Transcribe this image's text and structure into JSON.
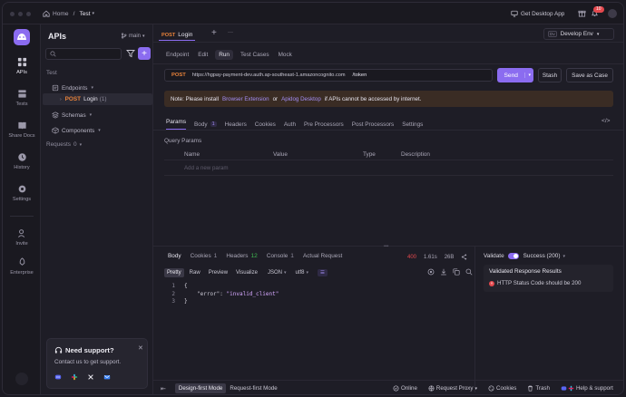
{
  "topbar": {
    "home": "Home",
    "sep": "/",
    "project": "Test",
    "get_desktop": "Get Desktop App",
    "notif_count": "10"
  },
  "rail": {
    "items": [
      {
        "label": "APIs"
      },
      {
        "label": "Tests"
      },
      {
        "label": "Share Docs"
      },
      {
        "label": "History"
      },
      {
        "label": "Settings"
      },
      {
        "label": "Invite"
      },
      {
        "label": "Enterprise"
      }
    ]
  },
  "sidebar": {
    "title": "APIs",
    "branch": "main",
    "tree": {
      "root": "Test",
      "endpoints": "Endpoints",
      "method": "POST",
      "endpoint_name": "Login",
      "endpoint_count": "(1)",
      "schemas": "Schemas",
      "components": "Components",
      "requests": "Requests",
      "requests_count": "0"
    },
    "support": {
      "title": "Need support?",
      "subtitle": "Contact us to get support."
    }
  },
  "main": {
    "tab": {
      "method": "POST",
      "name": "Login"
    },
    "env": "Develop Env",
    "subtabs": [
      "Endpoint",
      "Edit",
      "Run",
      "Test Cases",
      "Mock"
    ],
    "request": {
      "method": "POST",
      "base_url": "https://hgpay-payment-dev.auth.ap-southeast-1.amazoncognito.com",
      "path": "/token",
      "send": "Send",
      "stash": "Stash",
      "save": "Save as Case"
    },
    "note": {
      "prefix": "Note: Please install",
      "link1": "Browser Extension",
      "or": "or",
      "link2": "Apidog Desktop",
      "suffix": "if APIs cannot be accessed by internet."
    },
    "param_tabs": [
      "Params",
      "Body",
      "Headers",
      "Cookies",
      "Auth",
      "Pre Processors",
      "Post Processors",
      "Settings"
    ],
    "body_count": "1",
    "query_params": {
      "label": "Query Params",
      "columns": [
        "Name",
        "Value",
        "Type",
        "Description"
      ],
      "add_placeholder": "Add a new param"
    },
    "response": {
      "tabs": [
        "Body",
        "Cookies",
        "Headers",
        "Console",
        "Actual Request"
      ],
      "cookies_count": "1",
      "headers_count": "12",
      "console_count": "1",
      "status": "400",
      "time": "1.61s",
      "size": "26B",
      "view_tabs": [
        "Pretty",
        "Raw",
        "Preview",
        "Visualize"
      ],
      "format": "JSON",
      "encoding": "utf8",
      "code": [
        "{",
        "\"error\": \"invalid_client\"",
        "}"
      ],
      "line_numbers": [
        "1",
        "2",
        "3"
      ],
      "json_key": "\"error\"",
      "json_colon": ": ",
      "json_value": "\"invalid_client\""
    },
    "validate": {
      "label": "Validate",
      "success": "Success (200)",
      "results_title": "Validated Response Results",
      "result_item": "HTTP Status Code should be 200"
    }
  },
  "bottombar": {
    "design_first": "Design-first Mode",
    "request_first": "Request-first Mode",
    "online": "Online",
    "request_proxy": "Request Proxy",
    "cookies": "Cookies",
    "trash": "Trash",
    "help": "Help & support"
  },
  "colors": {
    "accent": "#8b6cf0",
    "post": "#e8823a",
    "error": "#e5484d",
    "note_bg": "#3a2c24"
  }
}
